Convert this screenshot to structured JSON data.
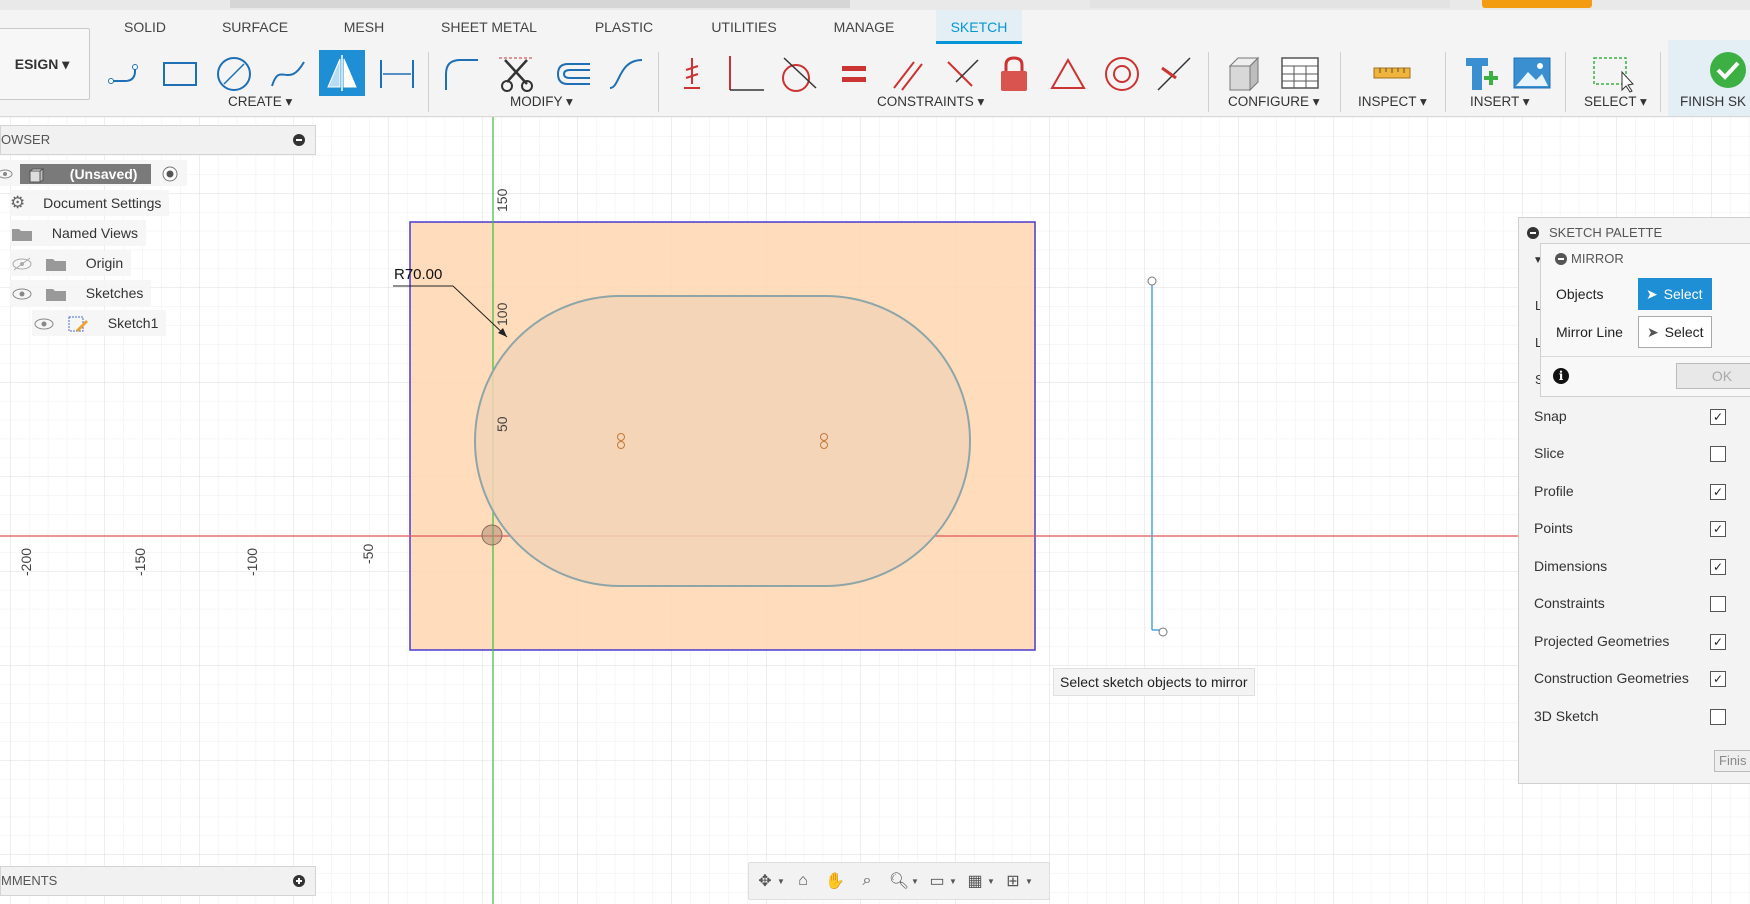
{
  "tabs": [
    "SOLID",
    "SURFACE",
    "MESH",
    "SHEET METAL",
    "PLASTIC",
    "UTILITIES",
    "MANAGE",
    "SKETCH"
  ],
  "active_tab": "SKETCH",
  "workspace": {
    "label": "ESIGN ▾"
  },
  "toolbar_groups": {
    "create": "CREATE ▾",
    "modify": "MODIFY ▾",
    "constraints": "CONSTRAINTS ▾",
    "configure": "CONFIGURE ▾",
    "inspect": "INSPECT ▾",
    "insert": "INSERT ▾",
    "select": "SELECT ▾",
    "finish": "FINISH SK"
  },
  "browser": {
    "title": "OWSER",
    "root": "(Unsaved)",
    "items": [
      "Document Settings",
      "Named Views",
      "Origin",
      "Sketches",
      "Sketch1"
    ]
  },
  "comments": {
    "title": "MMENTS"
  },
  "canvas": {
    "dimension": "R70.00",
    "v_ruler": [
      "150",
      "100",
      "50"
    ],
    "h_ruler": [
      "-200",
      "-150",
      "-100",
      "-50"
    ],
    "accent_axis_x": "#e05555",
    "accent_axis_y": "#3cbc3c",
    "profile_fill": "#ffd7b0"
  },
  "palette": {
    "title": "SKETCH PALETTE",
    "mirror": {
      "title": "MIRROR",
      "objects_label": "Objects",
      "objects_btn": "Select",
      "mirror_line_label": "Mirror Line",
      "mirror_line_btn": "Select",
      "ok": "OK"
    },
    "options": [
      {
        "label": "Snap",
        "checked": true
      },
      {
        "label": "Slice",
        "checked": false
      },
      {
        "label": "Profile",
        "checked": true
      },
      {
        "label": "Points",
        "checked": true
      },
      {
        "label": "Dimensions",
        "checked": true
      },
      {
        "label": "Constraints",
        "checked": false
      },
      {
        "label": "Projected Geometries",
        "checked": true
      },
      {
        "label": "Construction Geometries",
        "checked": true
      },
      {
        "label": "3D Sketch",
        "checked": false
      }
    ],
    "finish": "Finis"
  },
  "tooltip": "Select sketch objects to mirror"
}
